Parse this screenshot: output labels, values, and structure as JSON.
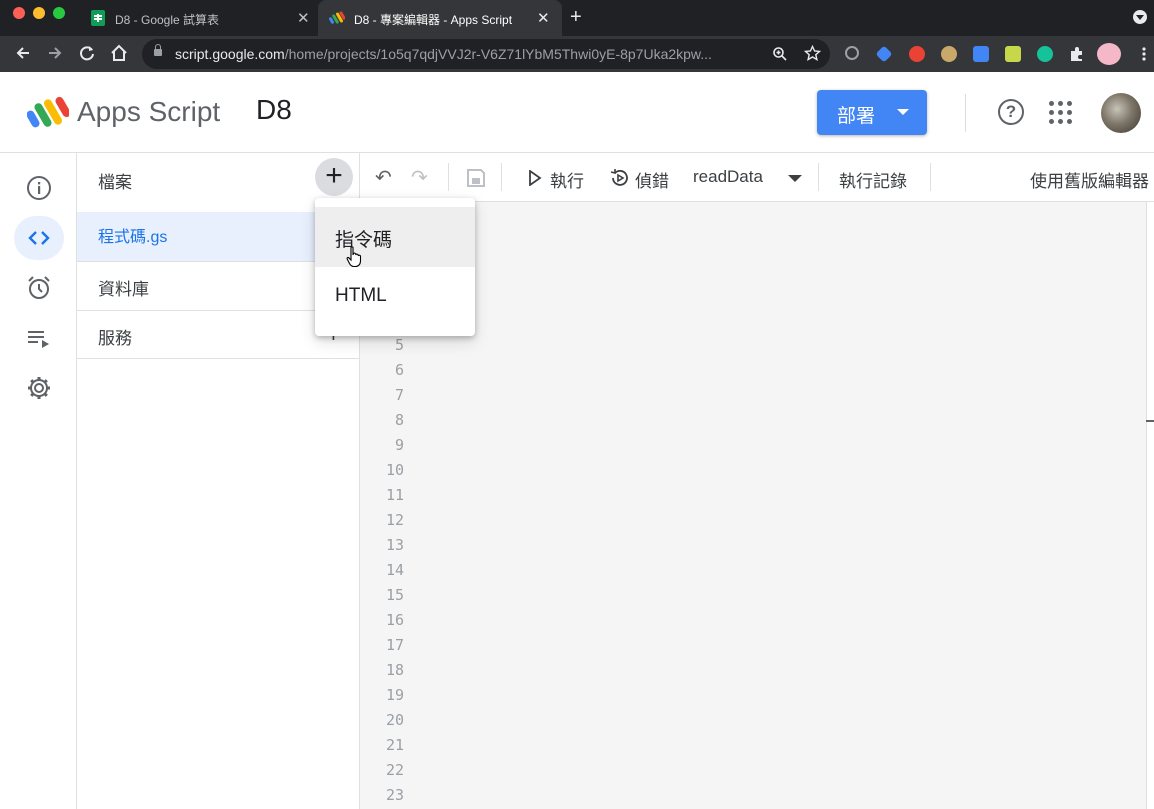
{
  "browser": {
    "tabs": [
      {
        "title": "D8 - Google 試算表",
        "icon": "google-sheets-icon",
        "active": false
      },
      {
        "title": "D8 - 專案編輯器 - Apps Script",
        "icon": "apps-script-icon",
        "active": true
      }
    ],
    "close_glyph": "✕",
    "new_tab_glyph": "+",
    "url_host": "script.google.com",
    "url_path": "/home/projects/1o5q7qdjVVJ2r-V6Z71lYbM5Thwi0yE-8p7Uka2kpw..."
  },
  "header": {
    "app_name": "Apps Script",
    "project_name": "D8",
    "deploy_label": "部署",
    "help_glyph": "?"
  },
  "colors": {
    "accent": "#1a73e8",
    "deploy_button": "#4285f4",
    "active_file_bg": "#e8f0fe"
  },
  "rail": {
    "items": [
      {
        "icon": "info-icon",
        "active": false
      },
      {
        "icon": "code-icon",
        "active": true
      },
      {
        "icon": "alarm-clock-icon",
        "active": false
      },
      {
        "icon": "executions-icon",
        "active": false
      },
      {
        "icon": "gear-icon",
        "active": false
      }
    ]
  },
  "files": {
    "title": "檔案",
    "add_glyph": "+",
    "active_file": "程式碼.gs",
    "sections": [
      "資料庫",
      "服務"
    ],
    "section_plus": "+"
  },
  "toolbar": {
    "undo_glyph": "↶",
    "redo_glyph": "↷",
    "run_label": "執行",
    "debug_label": "偵錯",
    "function_name": "readData",
    "log_label": "執行記錄",
    "legacy_label": "使用舊版編輯器"
  },
  "editor": {
    "line_numbers": [
      "5",
      "6",
      "7",
      "8",
      "9",
      "10",
      "11",
      "12",
      "13",
      "14",
      "15",
      "16",
      "17",
      "18",
      "19",
      "20",
      "21",
      "22",
      "23"
    ]
  },
  "new_file_menu": {
    "items": [
      "指令碼",
      "HTML"
    ],
    "hovered_index": 0
  }
}
